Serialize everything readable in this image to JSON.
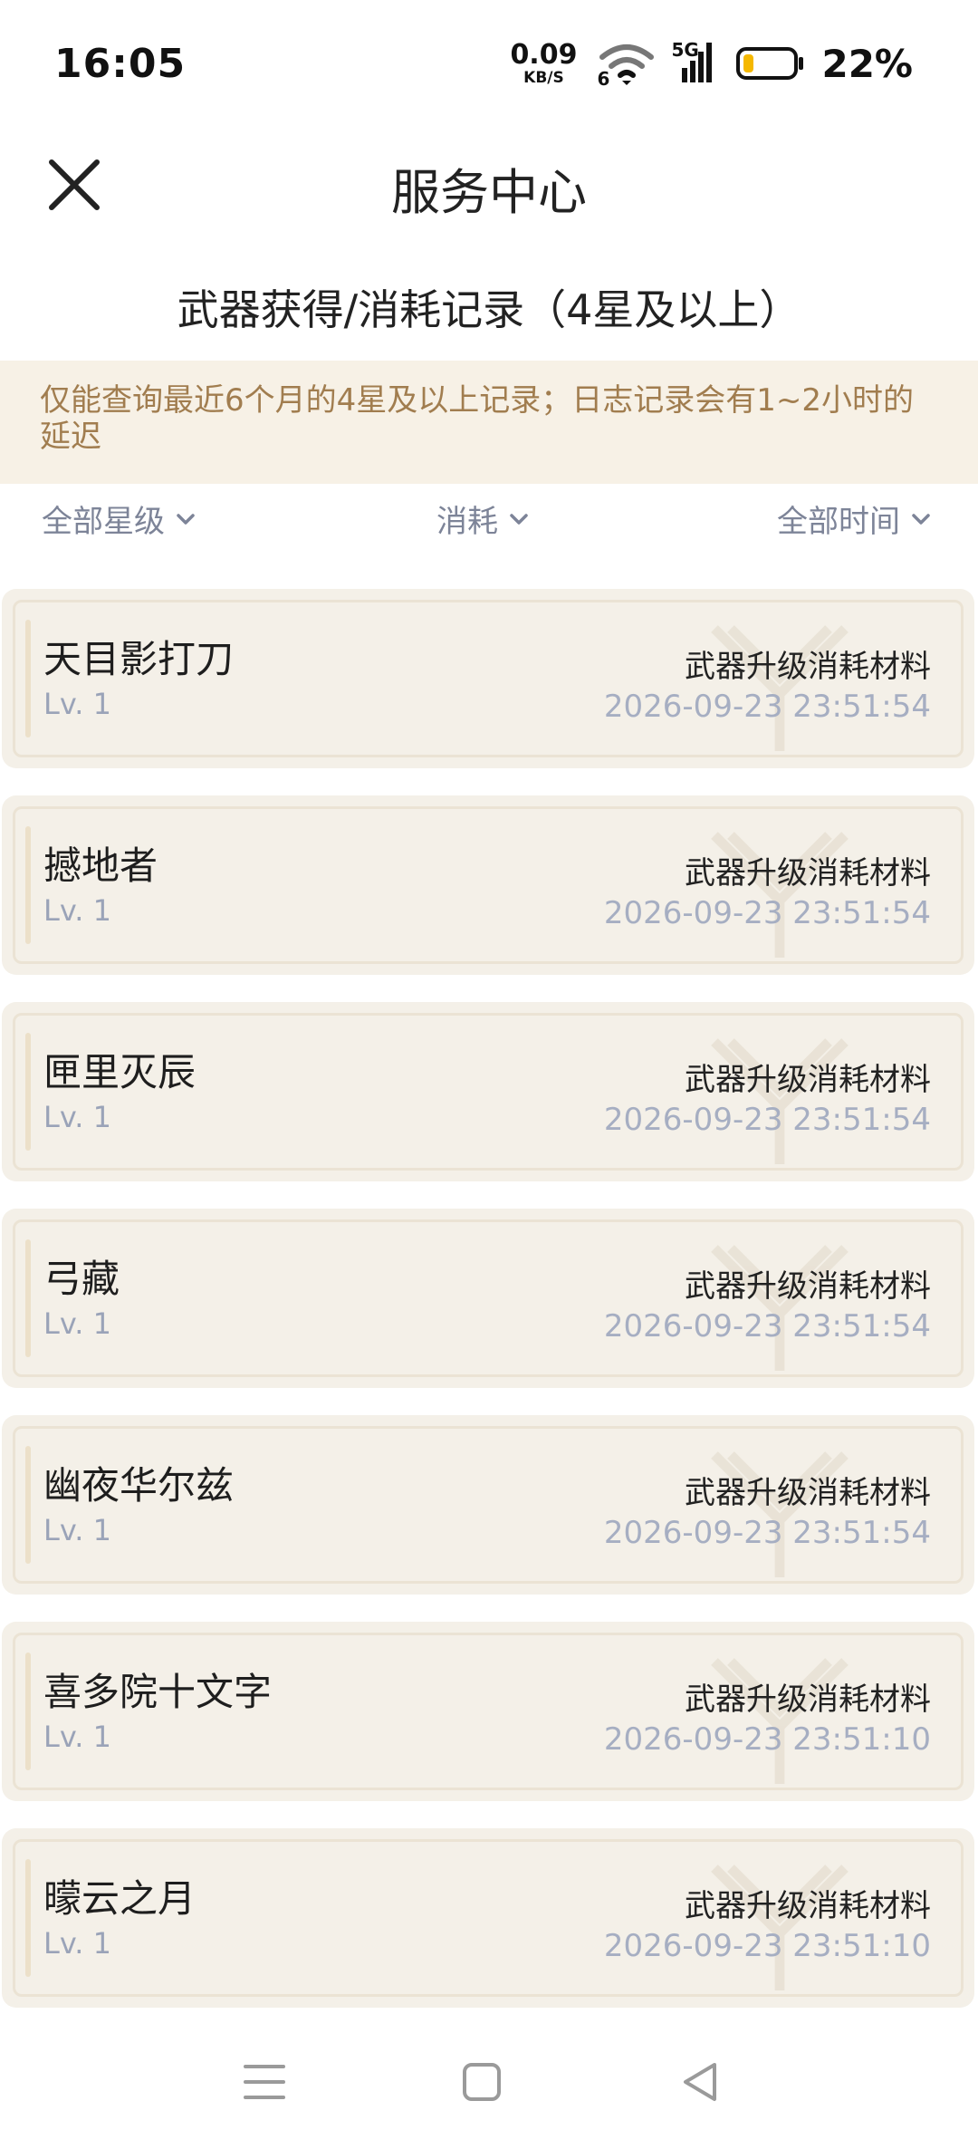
{
  "status_bar": {
    "time": "16:05",
    "net_speed_value": "0.09",
    "net_speed_unit": "KB/S",
    "wifi_sub": "6",
    "cell_label": "5G",
    "battery_percent": "22%",
    "battery_level": 0.22,
    "battery_color": "#f5b800"
  },
  "header": {
    "title": "服务中心"
  },
  "subtitle": "武器获得/消耗记录（4星及以上）",
  "notice": "仅能查询最近6个月的4星及以上记录；日志记录会有1~2小时的延迟",
  "filters": {
    "star": "全部星级",
    "type": "消耗",
    "time": "全部时间"
  },
  "records": [
    {
      "name": "天目影打刀",
      "level": "Lv. 1",
      "action": "武器升级消耗材料",
      "time": "2026-09-23 23:51:54"
    },
    {
      "name": "撼地者",
      "level": "Lv. 1",
      "action": "武器升级消耗材料",
      "time": "2026-09-23 23:51:54"
    },
    {
      "name": "匣里灭辰",
      "level": "Lv. 1",
      "action": "武器升级消耗材料",
      "time": "2026-09-23 23:51:54"
    },
    {
      "name": "弓藏",
      "level": "Lv. 1",
      "action": "武器升级消耗材料",
      "time": "2026-09-23 23:51:54"
    },
    {
      "name": "幽夜华尔兹",
      "level": "Lv. 1",
      "action": "武器升级消耗材料",
      "time": "2026-09-23 23:51:54"
    },
    {
      "name": "喜多院十文字",
      "level": "Lv. 1",
      "action": "武器升级消耗材料",
      "time": "2026-09-23 23:51:10"
    },
    {
      "name": "曚云之月",
      "level": "Lv. 1",
      "action": "武器升级消耗材料",
      "time": "2026-09-23 23:51:10"
    }
  ],
  "colors": {
    "accent_text": "#a17d4f",
    "notice_bg": "#f7f1e6",
    "card_bg": "#f4f0e8",
    "muted": "#a6aec2"
  }
}
